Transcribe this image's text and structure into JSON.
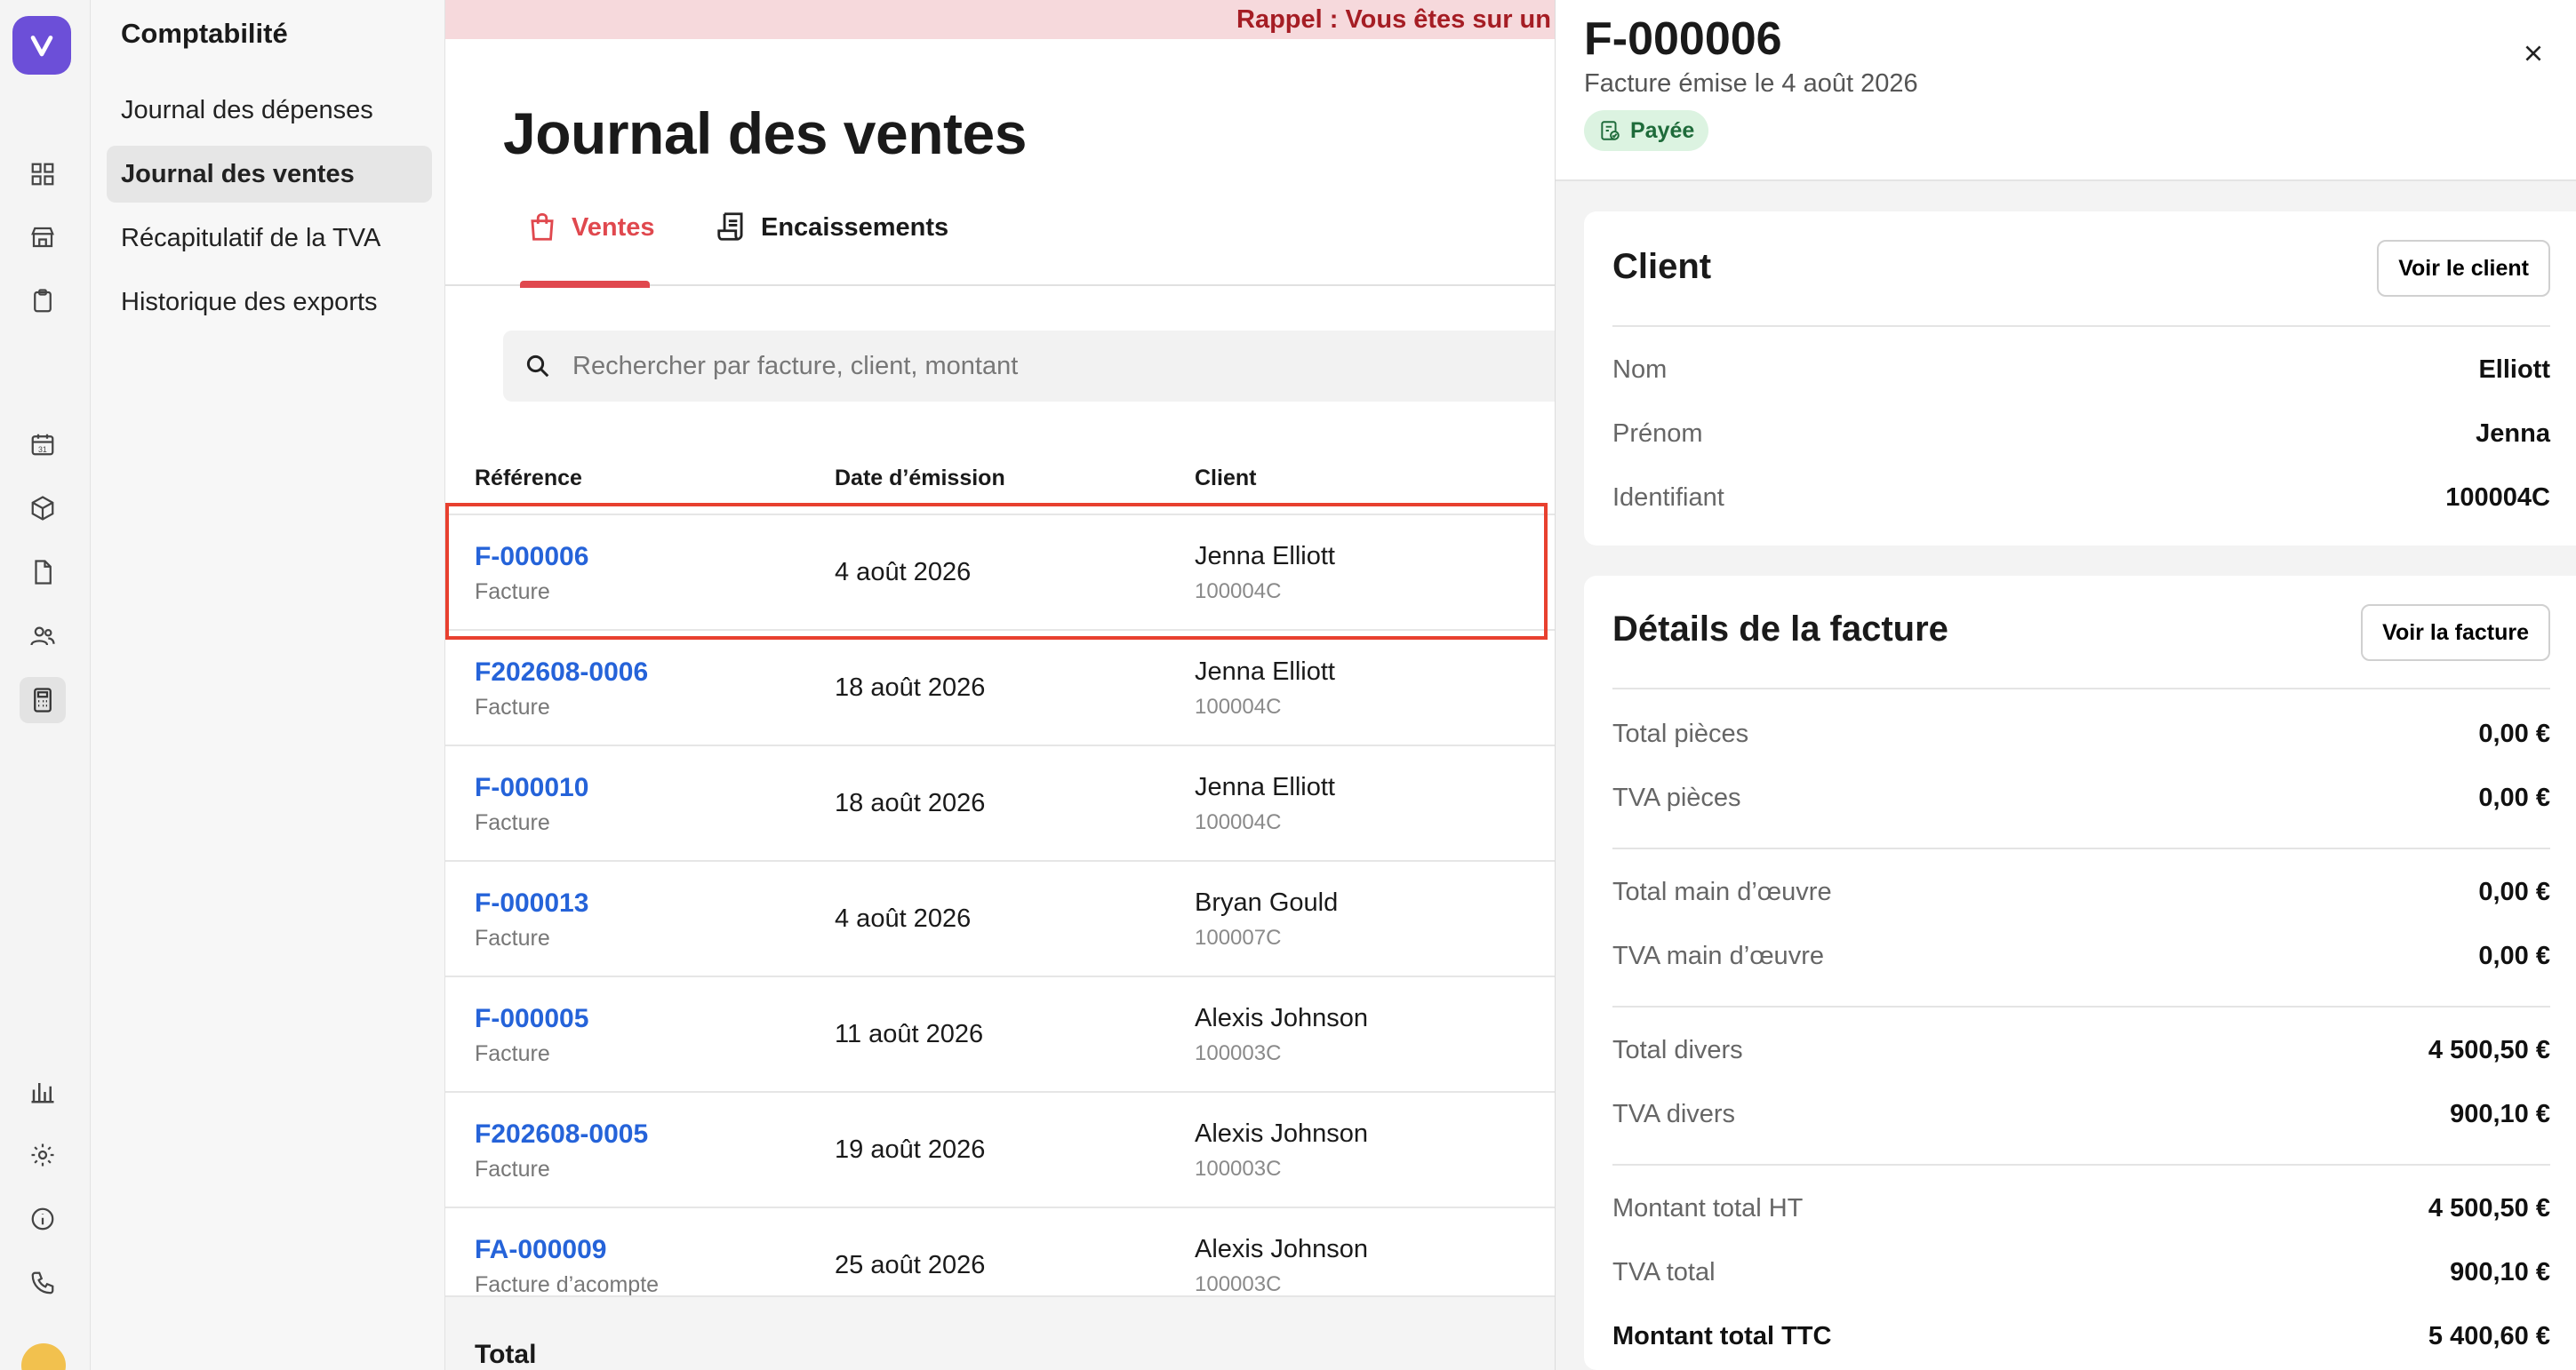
{
  "rail": {
    "icons": [
      "grid-icon",
      "store-icon",
      "clipboard-icon",
      "calendar-icon",
      "box-icon",
      "document-icon",
      "users-icon",
      "calculator-icon",
      "chart-icon",
      "gear-icon",
      "info-icon",
      "phone-icon"
    ]
  },
  "subnav": {
    "title": "Comptabilité",
    "items": [
      {
        "label": "Journal des dépenses"
      },
      {
        "label": "Journal des ventes",
        "active": true
      },
      {
        "label": "Récapitulatif de la TVA"
      },
      {
        "label": "Historique des exports"
      }
    ]
  },
  "main": {
    "banner": "Rappel : Vous êtes sur un e",
    "title": "Journal des ventes",
    "tabs": [
      {
        "label": "Ventes",
        "active": true
      },
      {
        "label": "Encaissements"
      }
    ],
    "search_placeholder": "Rechercher par facture, client, montant",
    "columns": [
      "Référence",
      "Date d’émission",
      "Client"
    ],
    "rows": [
      {
        "ref": "F-000006",
        "type": "Facture",
        "date": "4 août 2026",
        "client": "Jenna Elliott",
        "client_id": "100004C"
      },
      {
        "ref": "F202608-0006",
        "type": "Facture",
        "date": "18 août 2026",
        "client": "Jenna Elliott",
        "client_id": "100004C"
      },
      {
        "ref": "F-000010",
        "type": "Facture",
        "date": "18 août 2026",
        "client": "Jenna Elliott",
        "client_id": "100004C"
      },
      {
        "ref": "F-000013",
        "type": "Facture",
        "date": "4 août 2026",
        "client": "Bryan Gould",
        "client_id": "100007C"
      },
      {
        "ref": "F-000005",
        "type": "Facture",
        "date": "11 août 2026",
        "client": "Alexis Johnson",
        "client_id": "100003C"
      },
      {
        "ref": "F202608-0005",
        "type": "Facture",
        "date": "19 août 2026",
        "client": "Alexis Johnson",
        "client_id": "100003C"
      },
      {
        "ref": "FA-000009",
        "type": "Facture d’acompte",
        "date": "25 août 2026",
        "client": "Alexis Johnson",
        "client_id": "100003C"
      }
    ],
    "total_label": "Total"
  },
  "drawer": {
    "number": "F-000006",
    "subtitle": "Facture émise le 4 août 2026",
    "status": "Payée",
    "status_color": "#1e6b3a",
    "client": {
      "title": "Client",
      "button": "Voir le client",
      "fields": [
        {
          "label": "Nom",
          "value": "Elliott"
        },
        {
          "label": "Prénom",
          "value": "Jenna"
        },
        {
          "label": "Identifiant",
          "value": "100004C"
        }
      ]
    },
    "invoice": {
      "title": "Détails de la facture",
      "button": "Voir la facture",
      "fields": [
        {
          "label": "Total pièces",
          "value": "0,00 €"
        },
        {
          "label": "TVA pièces",
          "value": "0,00 €"
        },
        {
          "label": "Total main d’œuvre",
          "value": "0,00 €"
        },
        {
          "label": "TVA main d’œuvre",
          "value": "0,00 €"
        },
        {
          "label": "Total divers",
          "value": "4 500,50 €"
        },
        {
          "label": "TVA divers",
          "value": "900,10 €"
        },
        {
          "label": "Montant total HT",
          "value": "4 500,50 €"
        },
        {
          "label": "TVA total",
          "value": "900,10 €"
        },
        {
          "label": "Montant total TTC",
          "value": "5 400,60 €"
        }
      ]
    }
  },
  "colors": {
    "accent": "#e0484e",
    "link": "#2563d9",
    "brand": "#6c4fd8",
    "selection": "#e8402f"
  }
}
